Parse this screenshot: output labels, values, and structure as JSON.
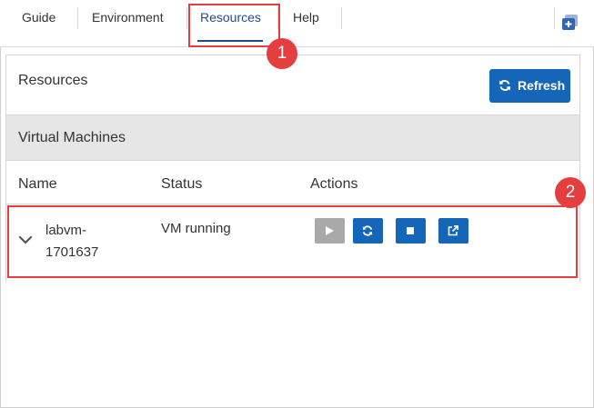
{
  "tabs": [
    {
      "label": "Guide"
    },
    {
      "label": "Environment"
    },
    {
      "label": "Resources",
      "active": true
    },
    {
      "label": "Help"
    }
  ],
  "callouts": [
    "1",
    "2"
  ],
  "panel": {
    "title": "Resources",
    "refresh_label": "Refresh",
    "section_title": "Virtual Machines",
    "columns": [
      "Name",
      "Status",
      "Actions"
    ],
    "rows": [
      {
        "name": "labvm-\n1701637",
        "status": "VM running",
        "actions": [
          "start-icon",
          "restart-icon",
          "stop-icon",
          "open-icon"
        ]
      }
    ]
  },
  "colors": {
    "accent": "#1565b9",
    "active_tab": "#1f4e8c",
    "callout": "#e53e3e",
    "disabled": "#a9a9a9",
    "section_bg": "#e6e6e6"
  }
}
